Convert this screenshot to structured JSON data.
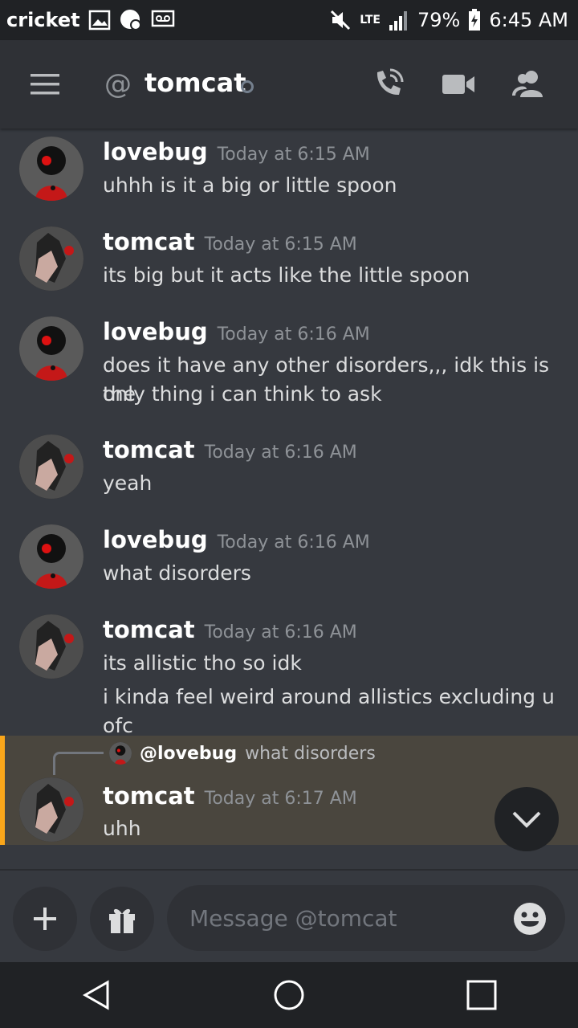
{
  "status_bar": {
    "carrier": "cricket",
    "network": "LTE",
    "battery": "79%",
    "time": "6:45 AM",
    "icons": [
      "image-icon",
      "notification-icon",
      "voicemail-icon",
      "mute-icon",
      "signal-icon",
      "battery-charging-icon"
    ]
  },
  "header": {
    "at_symbol": "@",
    "title": "tomcat",
    "icons": [
      "menu-icon",
      "voice-call-icon",
      "video-call-icon",
      "members-icon"
    ]
  },
  "messages": [
    {
      "author": "lovebug",
      "timestamp": "Today at 6:15 AM",
      "lines": [
        "uhhh is it a big or little spoon"
      ]
    },
    {
      "author": "tomcat",
      "timestamp": "Today at 6:15 AM",
      "lines": [
        "its big but it acts like the little spoon"
      ]
    },
    {
      "author": "lovebug",
      "timestamp": "Today at 6:16 AM",
      "lines": [
        "does it have any other disorders,,, idk this is the",
        "only thing i can think to ask"
      ]
    },
    {
      "author": "tomcat",
      "timestamp": "Today at 6:16 AM",
      "lines": [
        "yeah"
      ]
    },
    {
      "author": "lovebug",
      "timestamp": "Today at 6:16 AM",
      "lines": [
        "what disorders"
      ]
    },
    {
      "author": "tomcat",
      "timestamp": "Today at 6:16 AM",
      "lines": [
        "its allistic tho so idk",
        "i kinda feel weird around allistics excluding u ofc"
      ]
    }
  ],
  "reply_message": {
    "reply_to_author": "@lovebug",
    "reply_to_text": "what disorders",
    "author": "tomcat",
    "timestamp": "Today at 6:17 AM",
    "text": "uhh"
  },
  "composer": {
    "placeholder": "Message @tomcat",
    "icons": [
      "add-icon",
      "gift-icon",
      "emoji-icon"
    ]
  },
  "nav": {
    "icons": [
      "back-icon",
      "home-icon",
      "recents-icon"
    ]
  },
  "colors": {
    "background": "#36393f",
    "header": "#2f3136",
    "reply_highlight": "#4a463e",
    "reply_accent": "#faa61a"
  }
}
